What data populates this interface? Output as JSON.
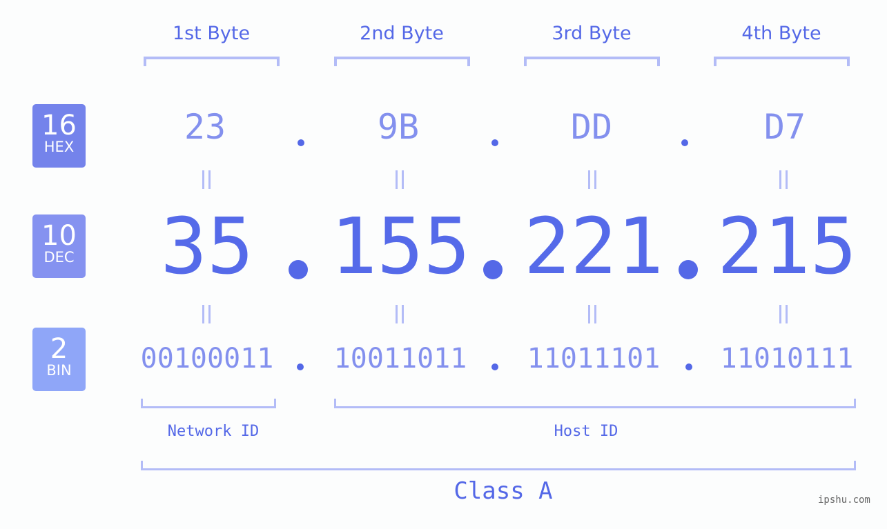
{
  "byte_headers": [
    "1st Byte",
    "2nd Byte",
    "3rd Byte",
    "4th Byte"
  ],
  "bases": [
    {
      "number": "16",
      "label": "HEX",
      "color": "#7483eb"
    },
    {
      "number": "10",
      "label": "DEC",
      "color": "#8592f0"
    },
    {
      "number": "2",
      "label": "BIN",
      "color": "#8fa6f8"
    }
  ],
  "hex": [
    "23",
    "9B",
    "DD",
    "D7"
  ],
  "dec": [
    "35",
    "155",
    "221",
    "215"
  ],
  "bin": [
    "00100011",
    "10011011",
    "11011101",
    "11010111"
  ],
  "network_id_label": "Network ID",
  "host_id_label": "Host ID",
  "class_label": "Class A",
  "watermark": "ipshu.com",
  "colors": {
    "primary": "#5468e7",
    "light": "#8390ee",
    "bracket": "#b3bcf7",
    "background": "#fcfdfd"
  }
}
